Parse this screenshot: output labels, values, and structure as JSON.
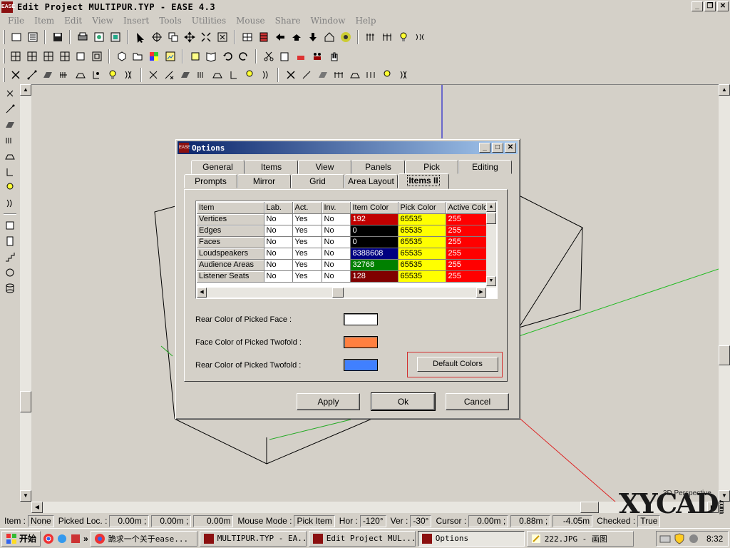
{
  "app": {
    "title": "Edit Project MULTIPUR.TYP - EASE 4.3",
    "logo_text": "EASE"
  },
  "menu": [
    "File",
    "Item",
    "Edit",
    "View",
    "Insert",
    "Tools",
    "Utilities",
    "Mouse",
    "Share",
    "Window",
    "Help"
  ],
  "window_buttons": {
    "minimize": "_",
    "restore": "❐",
    "close": "✕"
  },
  "dialog": {
    "title": "Options",
    "tabs_back": [
      "General",
      "Items",
      "View",
      "Panels",
      "Pick",
      "Editing"
    ],
    "tabs_front": [
      "Prompts",
      "Mirror",
      "Grid",
      "Area Layout",
      "Items II"
    ],
    "selected_tab": "Items II",
    "grid": {
      "columns": [
        "Item",
        "Lab.",
        "Act.",
        "Inv.",
        "Item Color",
        "Pick Color",
        "Active Colo"
      ],
      "rows": [
        {
          "item": "Vertices",
          "lab": "No",
          "act": "Yes",
          "inv": "No",
          "item_color": "192",
          "pick_color": "65535",
          "active_color": "255"
        },
        {
          "item": "Edges",
          "lab": "No",
          "act": "Yes",
          "inv": "No",
          "item_color": "0",
          "pick_color": "65535",
          "active_color": "255"
        },
        {
          "item": "Faces",
          "lab": "No",
          "act": "Yes",
          "inv": "No",
          "item_color": "0",
          "pick_color": "65535",
          "active_color": "255"
        },
        {
          "item": "Loudspeakers",
          "lab": "No",
          "act": "Yes",
          "inv": "No",
          "item_color": "8388608",
          "pick_color": "65535",
          "active_color": "255"
        },
        {
          "item": "Audience Areas",
          "lab": "No",
          "act": "Yes",
          "inv": "No",
          "item_color": "32768",
          "pick_color": "65535",
          "active_color": "255"
        },
        {
          "item": "Listener Seats",
          "lab": "No",
          "act": "Yes",
          "inv": "No",
          "item_color": "128",
          "pick_color": "65535",
          "active_color": "255"
        }
      ],
      "item_color_fills": [
        "#c00000",
        "#000000",
        "#000000",
        "#000080",
        "#008000",
        "#800000"
      ],
      "pick_color_fill": "#ffff00",
      "active_color_fill": "#ff0000"
    },
    "color_settings": [
      {
        "label": "Rear Color of Picked Face :",
        "color": "#ffffff"
      },
      {
        "label": "Face Color of Picked Twofold :",
        "color": "#ff8040"
      },
      {
        "label": "Rear Color of Picked Twofold :",
        "color": "#4080ff"
      }
    ],
    "default_colors_label": "Default Colors",
    "buttons": {
      "apply": "Apply",
      "ok": "Ok",
      "cancel": "Cancel"
    }
  },
  "status": {
    "item_label": "Item :",
    "item_value": "None",
    "picked_label": "Picked Loc. :",
    "picked_x": "0.00m ;",
    "picked_y": "0.00m ;",
    "picked_z": "0.00m",
    "mouse_mode_label": "Mouse Mode :",
    "mouse_mode_value": "Pick Item",
    "hor_label": "Hor :",
    "hor_value": "-120°",
    "ver_label": "Ver :",
    "ver_value": "-30°",
    "cursor_label": "Cursor :",
    "cursor_x": "0.00m ;",
    "cursor_y": "0.88m ;",
    "cursor_z": "-4.05m",
    "checked_label": "Checked :",
    "checked_value": "True"
  },
  "viewport": {
    "mode": "3D Perspective"
  },
  "taskbar": {
    "start": "开始",
    "quick_more": "»",
    "tasks": [
      {
        "label": "跪求一个关于ease...",
        "active": false
      },
      {
        "label": "MULTIPUR.TYP - EA...",
        "active": false
      },
      {
        "label": "Edit Project MUL...",
        "active": false
      },
      {
        "label": "Options",
        "active": true
      },
      {
        "label": "222.JPG - 画图",
        "active": false
      }
    ],
    "clock": "8:32"
  },
  "watermark": {
    "text": "XYCAD",
    "suffix": ".com"
  }
}
